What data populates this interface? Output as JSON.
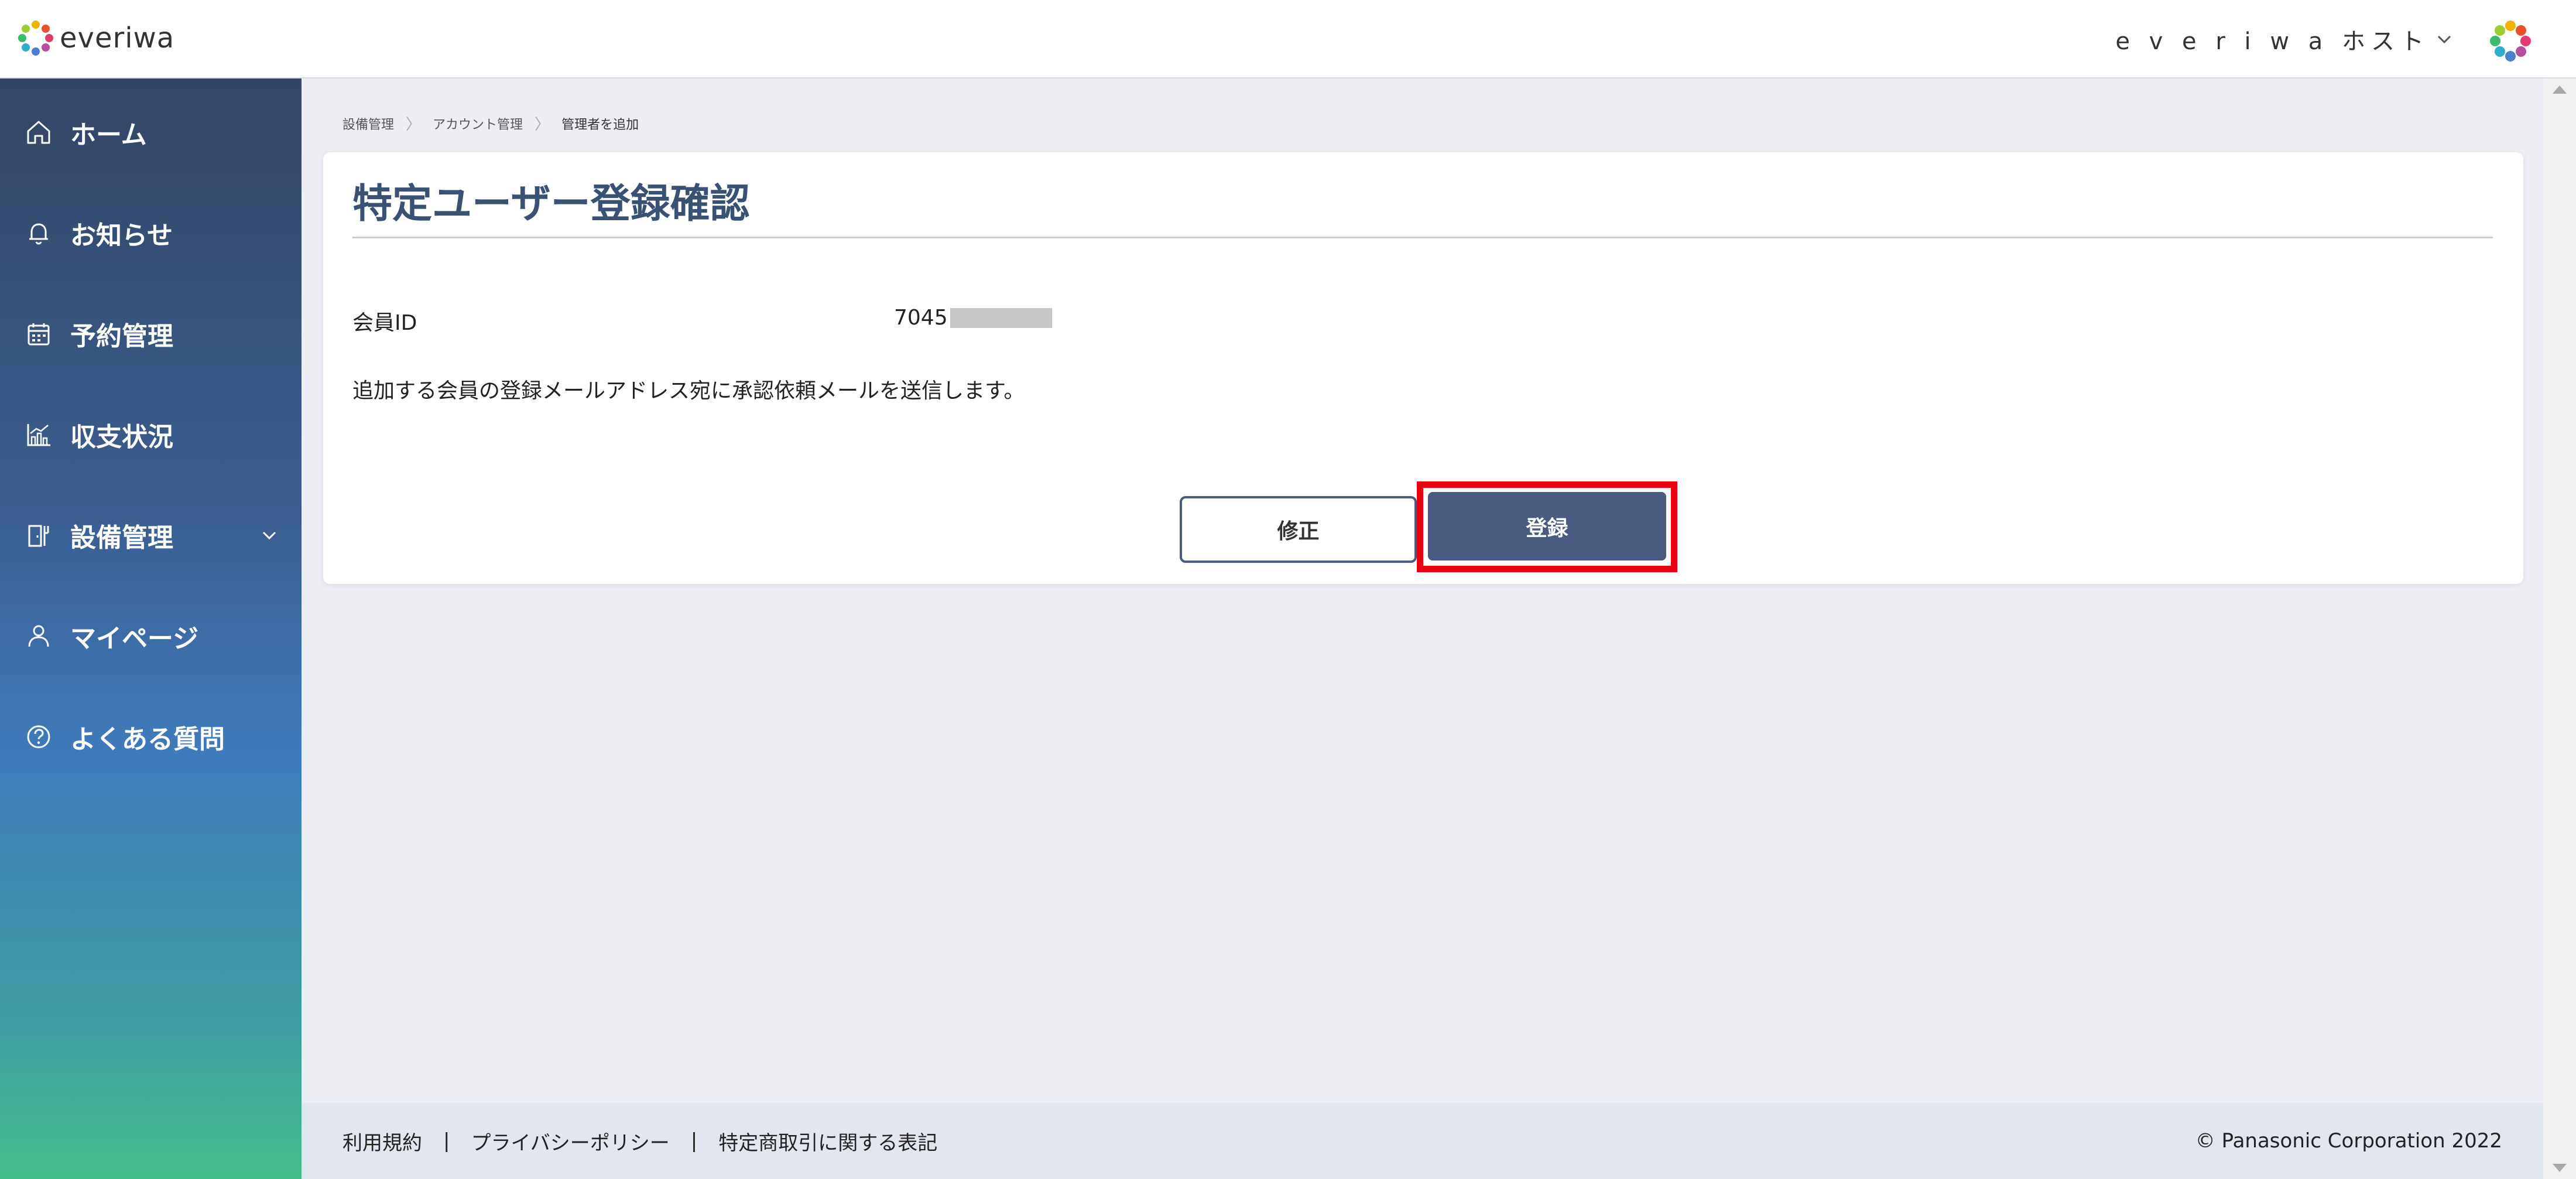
{
  "header": {
    "logo_text": "everiwa",
    "host_name": "e v e r i w a ホスト"
  },
  "sidebar": {
    "items": [
      {
        "label": "ホーム",
        "icon": "home-icon"
      },
      {
        "label": "お知らせ",
        "icon": "bell-icon"
      },
      {
        "label": "予約管理",
        "icon": "calendar-icon"
      },
      {
        "label": "収支状況",
        "icon": "chart-icon"
      },
      {
        "label": "設備管理",
        "icon": "facility-icon",
        "expandable": true
      },
      {
        "label": "マイページ",
        "icon": "user-icon"
      },
      {
        "label": "よくある質問",
        "icon": "help-icon"
      }
    ]
  },
  "breadcrumb": {
    "items": [
      "設備管理",
      "アカウント管理",
      "管理者を追加"
    ]
  },
  "main": {
    "title": "特定ユーザー登録確認",
    "member_id_label": "会員ID",
    "member_id_value": "7045",
    "notice": "追加する会員の登録メールアドレス宛に承認依頼メールを送信します。",
    "edit_button": "修正",
    "register_button": "登録"
  },
  "footer": {
    "links": [
      "利用規約",
      "プライバシーポリシー",
      "特定商取引に関する表記"
    ],
    "separator": "|",
    "copyright": "© Panasonic Corporation 2022"
  },
  "colors": {
    "accent": "#4a5a80",
    "title": "#3a5173",
    "highlight": "#e8000f"
  }
}
